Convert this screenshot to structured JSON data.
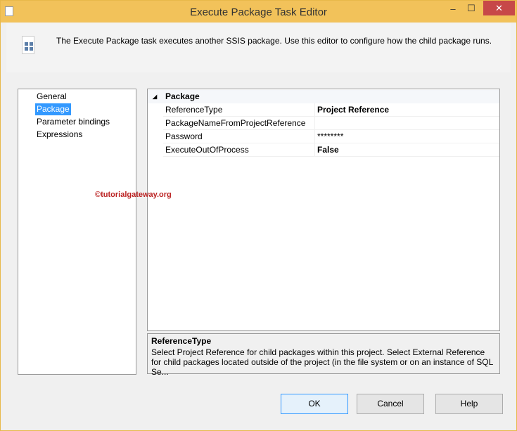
{
  "window": {
    "title": "Execute Package Task Editor",
    "minimize": "–",
    "maximize": "☐",
    "close": "✕"
  },
  "header": {
    "text": "The Execute Package task executes another SSIS package. Use this editor to configure how the child package runs."
  },
  "nav": {
    "items": [
      "General",
      "Package",
      "Parameter bindings",
      "Expressions"
    ],
    "selected": "Package"
  },
  "grid": {
    "category": "Package",
    "rows": [
      {
        "name": "ReferenceType",
        "value": "Project Reference"
      },
      {
        "name": "PackageNameFromProjectReference",
        "value": ""
      },
      {
        "name": "Password",
        "value": "********"
      },
      {
        "name": "ExecuteOutOfProcess",
        "value": "False"
      }
    ]
  },
  "description": {
    "title": "ReferenceType",
    "text": "Select Project Reference for child packages within this project. Select External Reference for child packages located outside of the project (in the file system or on an instance of SQL Se..."
  },
  "watermark": "©tutorialgateway.org",
  "buttons": {
    "ok": "OK",
    "cancel": "Cancel",
    "help": "Help"
  }
}
